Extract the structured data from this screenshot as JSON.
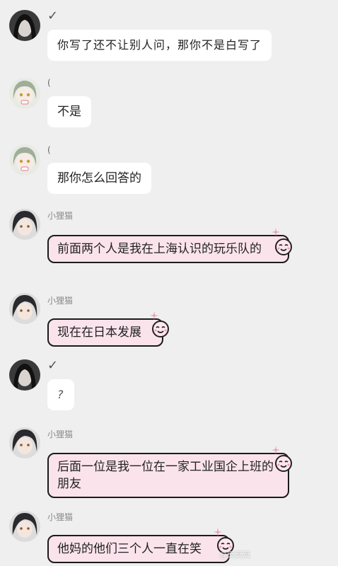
{
  "messages": [
    {
      "sender": "✓",
      "text": "你写了还不让别人问，那你不是白写了"
    },
    {
      "sender": "(",
      "text": "不是"
    },
    {
      "sender": "(",
      "text": "那你怎么回答的"
    },
    {
      "sender": "小狸猫",
      "text": "前面两个人是我在上海认识的玩乐队的"
    },
    {
      "sender": "小狸猫",
      "text": "现在在日本发展"
    },
    {
      "sender": "✓",
      "text": "?"
    },
    {
      "sender": "小狸猫",
      "text": "后面一位是我一位在一家工业国企上班的朋友"
    },
    {
      "sender": "小狸猫",
      "text": "他妈的他们三个人一直在笑"
    }
  ],
  "watermark": "@冥冥冥"
}
